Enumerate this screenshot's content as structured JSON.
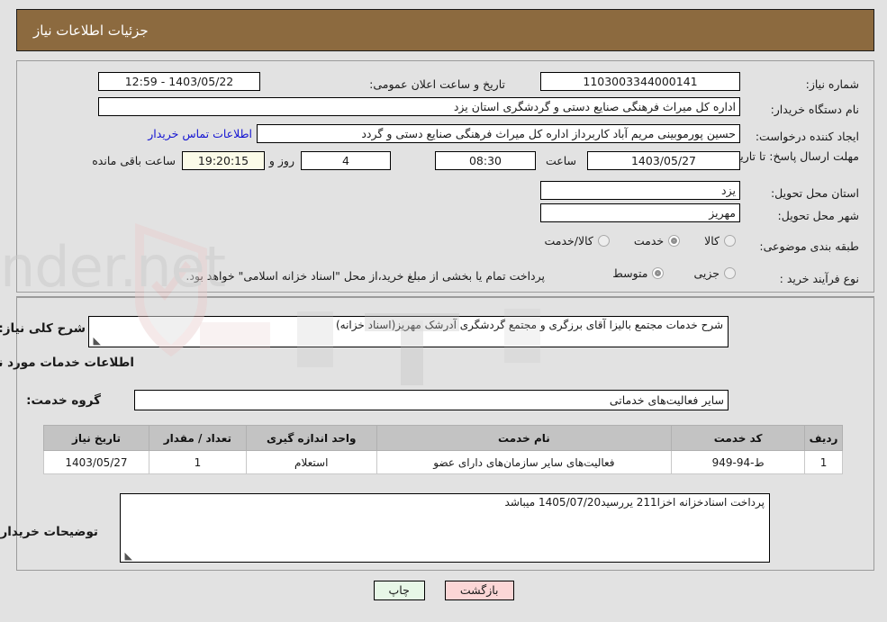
{
  "header": {
    "title": "جزئیات اطلاعات نیاز"
  },
  "colors": {
    "header_bg": "#8c6a3f",
    "page_bg": "#e2e2e2",
    "link": "#1414d2",
    "timer_bg": "#fbfbe8",
    "print_btn_bg": "#e7f7e7",
    "back_btn_bg": "#fbd6d6",
    "table_header_bg": "#c3c3c3"
  },
  "form": {
    "need_number": {
      "label": "شماره نیاز:",
      "value": "1103003344000141"
    },
    "announce_datetime": {
      "label": "تاریخ و ساعت اعلان عمومی:",
      "value": "1403/05/22 - 12:59"
    },
    "buyer_org": {
      "label": "نام دستگاه خریدار:",
      "value": "اداره کل میراث فرهنگی  صنایع دستی و گردشگری استان یزد"
    },
    "requester": {
      "label": "ایجاد کننده درخواست:",
      "value": "حسین پورموبینی مریم آباد کاربرداز اداره کل میراث فرهنگی  صنایع دستی و گردد"
    },
    "contact_link": "اطلاعات تماس خریدار",
    "deadline": {
      "label": "مهلت ارسال پاسخ: تا تاریخ:",
      "value": "1403/05/27"
    },
    "deadline_time": {
      "label": "ساعت",
      "value": "08:30"
    },
    "remaining_days": {
      "value": "4",
      "unit": "روز و"
    },
    "remaining_timer": {
      "value": "19:20:15",
      "suffix": "ساعت باقی مانده"
    },
    "delivery_province": {
      "label": "استان محل تحویل:",
      "value": "یزد"
    },
    "delivery_city": {
      "label": "شهر محل تحویل:",
      "value": "مهریز"
    },
    "category": {
      "label": "طبقه بندی موضوعی:",
      "options": [
        {
          "label": "کالا",
          "selected": false
        },
        {
          "label": "خدمت",
          "selected": true
        },
        {
          "label": "کالا/خدمت",
          "selected": false
        }
      ]
    },
    "purchase_type": {
      "label": "نوع فرآیند خرید :",
      "options": [
        {
          "label": "جزیی",
          "selected": false
        },
        {
          "label": "متوسط",
          "selected": true
        }
      ]
    },
    "treasury_note": "پرداخت تمام یا بخشی از مبلغ خرید،از محل \"اسناد خزانه اسلامی\" خواهد بود."
  },
  "need_summary": {
    "label": "شرح کلی نیاز:",
    "value": "شرح خدمات مجتمع بالیزا آقای برزگری و مجتمع گردشگری آدرشک مهریز(اسناد خزانه)"
  },
  "services_section": {
    "title": "اطلاعات خدمات مورد نیاز",
    "group_label": "گروه خدمت:",
    "group_value": "سایر فعالیت‌های خدماتی",
    "table": {
      "headers": [
        "ردیف",
        "کد خدمت",
        "نام خدمت",
        "واحد اندازه گیری",
        "تعداد / مقدار",
        "تاریخ نیاز"
      ],
      "rows": [
        [
          "1",
          "ط-94-949",
          "فعالیت‌های سایر سازمان‌های دارای عضو",
          "استعلام",
          "1",
          "1403/05/27"
        ]
      ]
    }
  },
  "buyer_notes": {
    "label": "توضیحات خریدار:",
    "value": "پرداخت اسنادخزانه اخزا211  یررسید1405/07/20 میباشد"
  },
  "footer": {
    "print_label": "چاپ",
    "back_label": "بازگشت"
  },
  "watermark": {
    "text": "AriaTender.net"
  }
}
